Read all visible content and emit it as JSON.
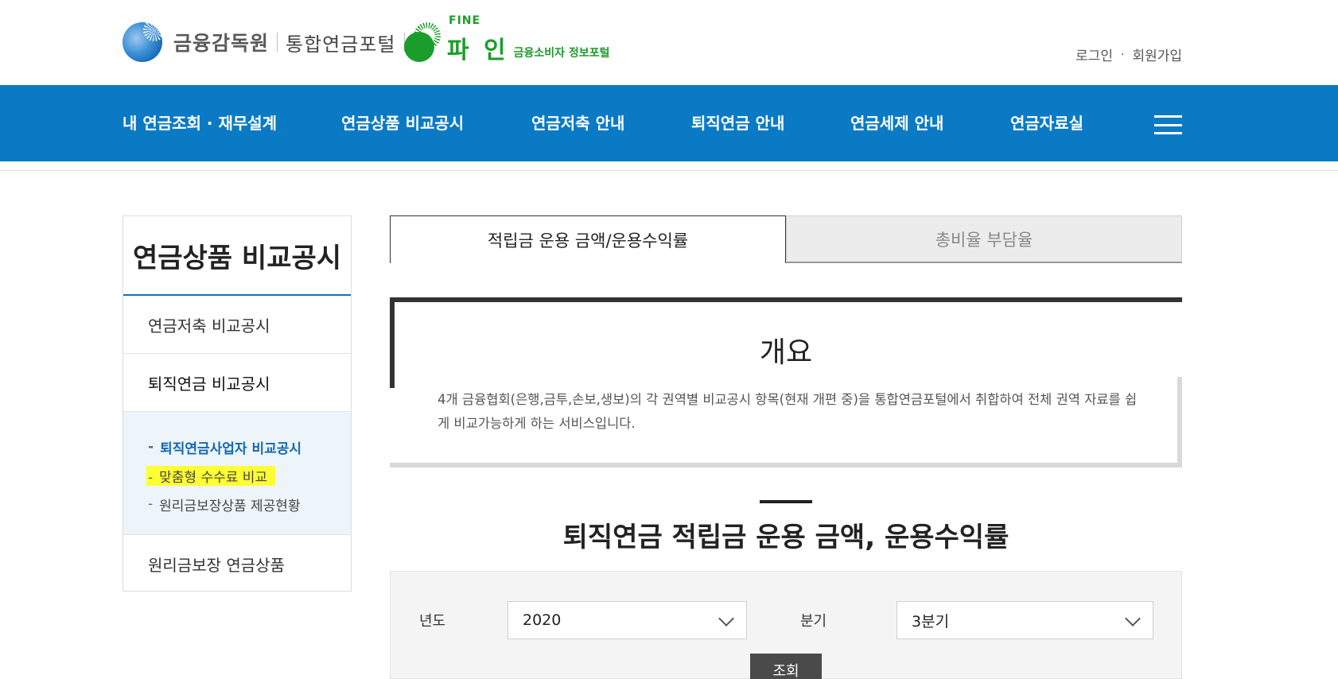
{
  "header": {
    "fss_name": "금융감독원",
    "portal_name": "통합연금포털",
    "fine_en": "FINE",
    "fine_ko": "파 인",
    "fine_sub": "금융소비자 정보포털",
    "login": "로그인",
    "separator": "·",
    "signup": "회원가입"
  },
  "nav": {
    "items": [
      "내 연금조회 · 재무설계",
      "연금상품 비교공시",
      "연금저축 안내",
      "퇴직연금 안내",
      "연금세제 안내",
      "연금자료실"
    ]
  },
  "sidebar": {
    "title": "연금상품 비교공시",
    "items": [
      "연금저축 비교공시",
      "퇴직연금 비교공시",
      "원리금보장 연금상품"
    ],
    "sub_items": [
      "퇴직연금사업자 비교공시",
      "맞춤형 수수료 비교",
      "원리금보장상품 제공현황"
    ],
    "sub_dash": "-"
  },
  "tabs": [
    "적립금 운용 금액/운용수익률",
    "총비율 부담율"
  ],
  "overview": {
    "title": "개요",
    "description": "4개 금융협회(은행,금투,손보,생보)의 각 권역별 비교공시 항목(현재 개편 중)을 통합연금포털에서 취합하여 전체 권역 자료를 쉽게 비교가능하게 하는 서비스입니다."
  },
  "section": {
    "title": "퇴직연금 적립금 운용 금액, 운용수익률"
  },
  "filter": {
    "year_label": "년도",
    "year_value": "2020",
    "quarter_label": "분기",
    "quarter_value": "3분기",
    "search_label": "조회"
  },
  "colors": {
    "nav_bg": "#0a7ac5",
    "brand_green": "#1a9d2a",
    "active_link": "#1567b2",
    "highlight": "#ffff33"
  }
}
